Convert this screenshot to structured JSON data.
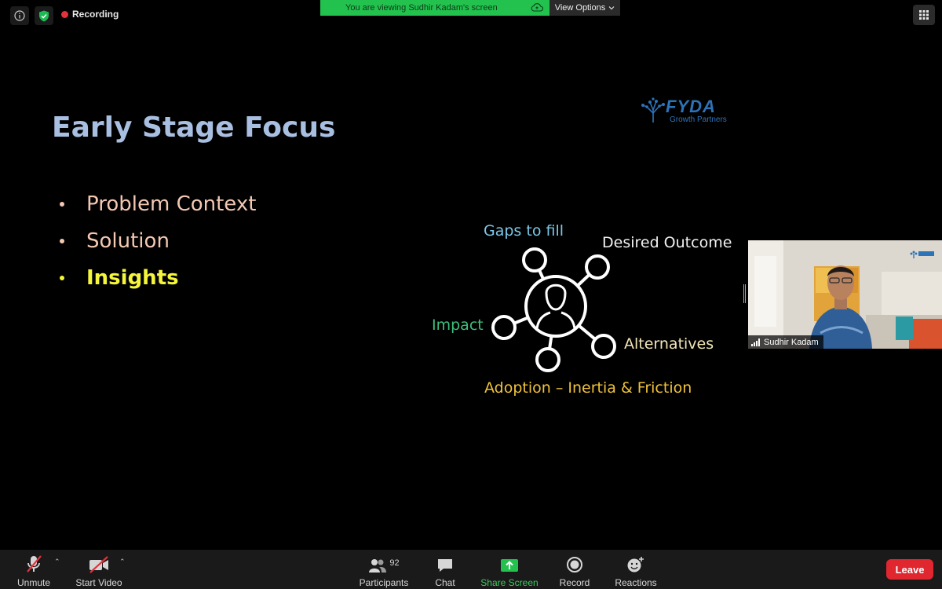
{
  "top_bar": {
    "recording_label": "Recording",
    "share_banner": "You are viewing Sudhir Kadam's screen",
    "view_options_label": "View Options",
    "icons": [
      "info-icon",
      "shield-check-icon",
      "cloud-icon",
      "chevron-down-icon",
      "gallery-grid-icon"
    ]
  },
  "slide": {
    "title": "Early Stage Focus",
    "bullets": [
      {
        "text": "Problem Context",
        "highlighted": false
      },
      {
        "text": "Solution",
        "highlighted": false
      },
      {
        "text": "Insights",
        "highlighted": true
      }
    ],
    "logo": {
      "name": "FYDA",
      "tagline": "Growth Partners"
    },
    "diagram": {
      "center": "person-icon",
      "labels": {
        "gaps": "Gaps to fill",
        "desired": "Desired Outcome",
        "impact": "Impact",
        "alternatives": "Alternatives",
        "adoption": "Adoption – Inertia & Friction"
      },
      "colors": {
        "gaps": "#7cc7e8",
        "desired": "#f2f2f2",
        "impact": "#3dbf7a",
        "alternatives": "#f2e6b8",
        "adoption": "#f0c23a"
      }
    }
  },
  "self_video": {
    "name": "Sudhir Kadam",
    "icons": [
      "signal-bars-icon"
    ]
  },
  "toolbar": {
    "unmute": "Unmute",
    "start_video": "Start Video",
    "participants": "Participants",
    "participants_count": "92",
    "chat": "Chat",
    "share_screen": "Share Screen",
    "record": "Record",
    "reactions": "Reactions",
    "leave": "Leave"
  },
  "colors": {
    "accent_green": "#23c24e",
    "leave_red": "#e0262e",
    "recording_red": "#e2323b",
    "title_blue": "#a9bfe1",
    "bullet_peach": "#f4c8b2",
    "highlight_yellow": "#f5f53b"
  }
}
